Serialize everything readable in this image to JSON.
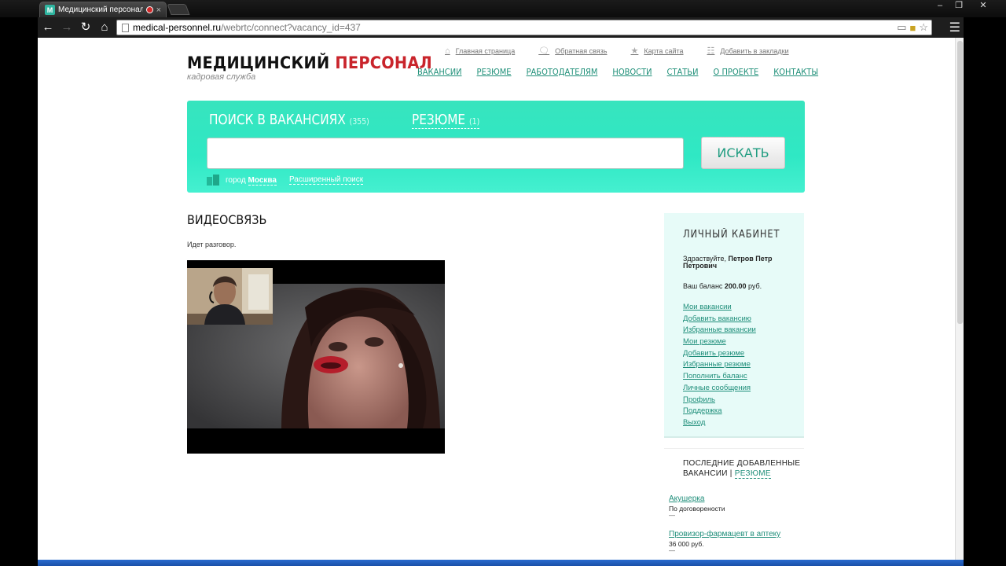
{
  "browser": {
    "tab_title": "Медицинский персонал",
    "tab_close": "×",
    "url_host": "medical-personnel.ru",
    "url_path": "/webrtc/connect?vacancy_id=437",
    "window_buttons": {
      "minimize": "–",
      "maximize": "❐",
      "close": "✕"
    }
  },
  "site": {
    "logo_main": "МЕДИЦИНСКИЙ ",
    "logo_accent": "ПЕРСОНАЛ",
    "logo_sub": "кадровая служба"
  },
  "toplinks": [
    {
      "label": "Главная страница",
      "icon": "home-icon"
    },
    {
      "label": "Обратная связь",
      "icon": "feedback-icon"
    },
    {
      "label": "Карта сайта",
      "icon": "star-icon"
    },
    {
      "label": "Добавить в закладки",
      "icon": "bookmark-icon"
    }
  ],
  "nav": [
    "ВАКАНСИИ",
    "РЕЗЮМЕ",
    "РАБОТОДАТЕЛЯМ",
    "НОВОСТИ",
    "СТАТЬИ",
    "О ПРОЕКТЕ",
    "КОНТАКТЫ"
  ],
  "search": {
    "title_vacancies": "ПОИСК В ВАКАНСИЯХ",
    "count_vacancies": "(355)",
    "title_resume": "РЕЗЮМЕ",
    "count_resume": "(1)",
    "input_value": "",
    "button": "ИСКАТЬ",
    "city_prefix": "город ",
    "city": "Москва",
    "advanced": "Расширенный поиск"
  },
  "content": {
    "title": "ВИДЕОСВЯЗЬ",
    "status": "Идет разговор."
  },
  "cabinet": {
    "title": "ЛИЧНЫЙ КАБИНЕТ",
    "greet_prefix": "Здраствуйте, ",
    "user_name": "Петров Петр Петрович",
    "balance_prefix": "Ваш баланс ",
    "balance_value": "200.00",
    "balance_suffix": " руб.",
    "links": [
      "Мои вакансии",
      "Добавить вакансию",
      "Избранные вакансии",
      "Мои резюме",
      "Добавить резюме",
      "Избранные резюме",
      "Пополнить баланс",
      "Личные сообщения",
      "Профиль",
      "Поддержка",
      "Выход"
    ]
  },
  "latest": {
    "title": "ПОСЛЕДНИЕ ДОБАВЛЕННЫЕ ВАКАНСИИ | ",
    "title_link": "РЕЗЮМЕ",
    "items": [
      {
        "name": "Акушерка",
        "salary": "По договорености",
        "dash": "—"
      },
      {
        "name": "Провизор-фармацевт в аптеку",
        "salary": "36 000 руб.",
        "dash": "—"
      }
    ]
  },
  "colors": {
    "accent": "#2fe8c4",
    "link": "#1f8e7a",
    "logo_red": "#c9242b"
  }
}
